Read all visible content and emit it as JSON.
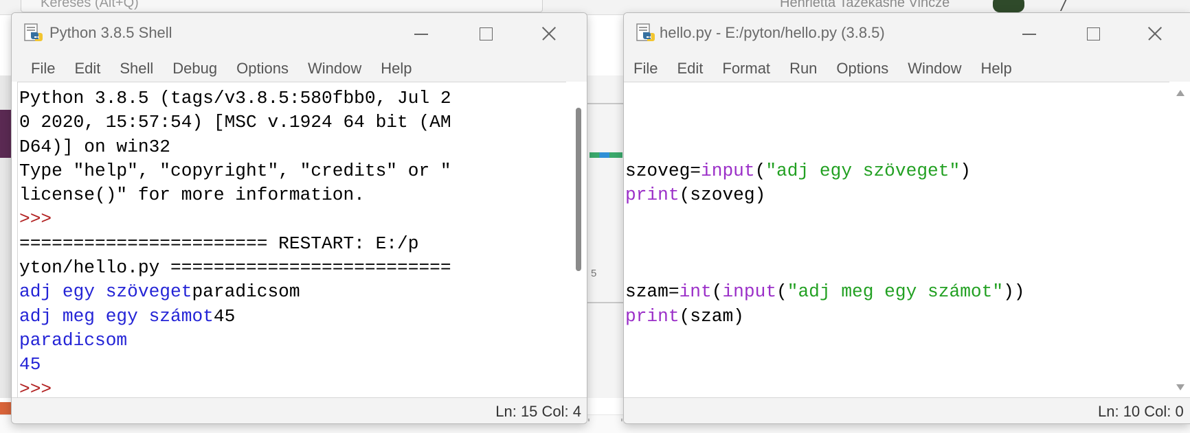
{
  "background": {
    "search_placeholder": "Keresés (Alt+Q)",
    "user_name": "Henrietta Tazekasne Vincze",
    "ruler_number": "5"
  },
  "shell": {
    "title": "Python 3.8.5 Shell",
    "menu": [
      "File",
      "Edit",
      "Shell",
      "Debug",
      "Options",
      "Window",
      "Help"
    ],
    "lines": [
      [
        {
          "t": "Python 3.8.5 (tags/v3.8.5:580fbb0, Jul 2",
          "c": "black"
        }
      ],
      [
        {
          "t": "0 2020, 15:57:54) [MSC v.1924 64 bit (AM",
          "c": "black"
        }
      ],
      [
        {
          "t": "D64)] on win32",
          "c": "black"
        }
      ],
      [
        {
          "t": "Type \"help\", \"copyright\", \"credits\" or \"",
          "c": "black"
        }
      ],
      [
        {
          "t": "license()\" for more information.",
          "c": "black"
        }
      ],
      [
        {
          "t": ">>> ",
          "c": "prompt"
        }
      ],
      [
        {
          "t": "======================= RESTART: E:/p",
          "c": "black"
        }
      ],
      [
        {
          "t": "yton/hello.py ==========================",
          "c": "black"
        }
      ],
      [
        {
          "t": "adj egy szöveget",
          "c": "blue"
        },
        {
          "t": "paradicsom",
          "c": "black"
        }
      ],
      [
        {
          "t": "adj meg egy számot",
          "c": "blue"
        },
        {
          "t": "45",
          "c": "black"
        }
      ],
      [
        {
          "t": "paradicsom",
          "c": "blue"
        }
      ],
      [
        {
          "t": "45",
          "c": "blue"
        }
      ],
      [
        {
          "t": ">>> ",
          "c": "prompt"
        }
      ]
    ],
    "status": "Ln: 15  Col: 4"
  },
  "editor": {
    "title": "hello.py - E:/pyton/hello.py (3.8.5)",
    "menu": [
      "File",
      "Edit",
      "Format",
      "Run",
      "Options",
      "Window",
      "Help"
    ],
    "lines": [
      [],
      [],
      [],
      [
        {
          "t": "szoveg=",
          "c": "black"
        },
        {
          "t": "input",
          "c": "builtin"
        },
        {
          "t": "(",
          "c": "black"
        },
        {
          "t": "\"adj egy szöveget\"",
          "c": "string"
        },
        {
          "t": ")",
          "c": "black"
        }
      ],
      [
        {
          "t": "print",
          "c": "builtin"
        },
        {
          "t": "(szoveg)",
          "c": "black"
        }
      ],
      [],
      [],
      [],
      [
        {
          "t": "szam=",
          "c": "black"
        },
        {
          "t": "int",
          "c": "builtin"
        },
        {
          "t": "(",
          "c": "black"
        },
        {
          "t": "input",
          "c": "builtin"
        },
        {
          "t": "(",
          "c": "black"
        },
        {
          "t": "\"adj meg egy számot\"",
          "c": "string"
        },
        {
          "t": "))",
          "c": "black"
        }
      ],
      [
        {
          "t": "print",
          "c": "builtin"
        },
        {
          "t": "(szam)",
          "c": "black"
        }
      ]
    ],
    "status": "Ln: 10  Col: 0"
  },
  "icons": {
    "window_icon": "python-idle-icon",
    "minimize": "minimize-icon",
    "maximize": "maximize-icon",
    "close": "close-icon"
  },
  "colors": {
    "output_blue": "#2424d6",
    "prompt_red": "#b22222",
    "builtin_purple": "#9b2fc8",
    "string_green": "#22a022"
  }
}
